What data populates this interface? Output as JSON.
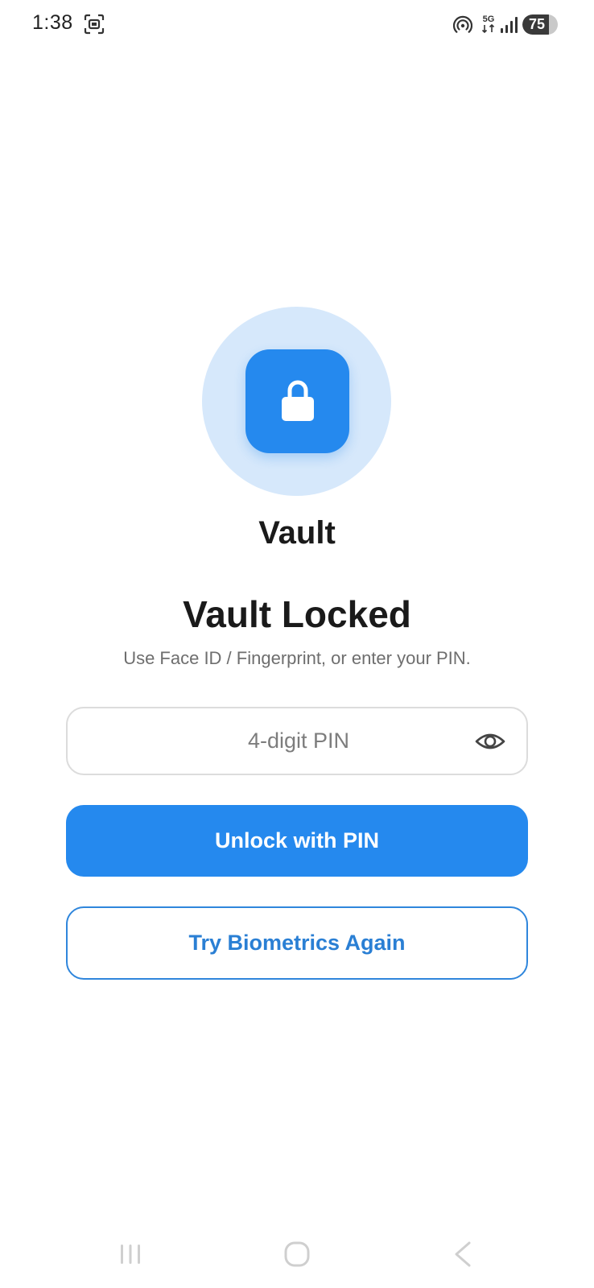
{
  "status_bar": {
    "time": "1:38",
    "battery_level": "75",
    "battery_fraction": 0.75,
    "network_label": "5G",
    "icons": [
      "screenshot-icon",
      "hotspot-icon",
      "network-5g-icon",
      "signal-icon",
      "battery-icon"
    ]
  },
  "lock_screen": {
    "app_name": "Vault",
    "title": "Vault Locked",
    "subtitle": "Use Face ID / Fingerprint, or enter your PIN.",
    "pin_placeholder": "4-digit PIN",
    "pin_value": "",
    "unlock_button_label": "Unlock with PIN",
    "biometrics_button_label": "Try Biometrics Again",
    "icons": [
      "lock-icon",
      "eye-icon"
    ]
  },
  "nav_bar": {
    "icons": [
      "recents-icon",
      "home-icon",
      "back-icon"
    ]
  },
  "colors": {
    "accent": "#2589ee",
    "accent_light": "#d6e8fb",
    "outline_button": "#2f86dc",
    "text_primary": "#1a1a1a",
    "text_secondary": "#6e6e6e",
    "input_border": "#dcdcdc"
  }
}
